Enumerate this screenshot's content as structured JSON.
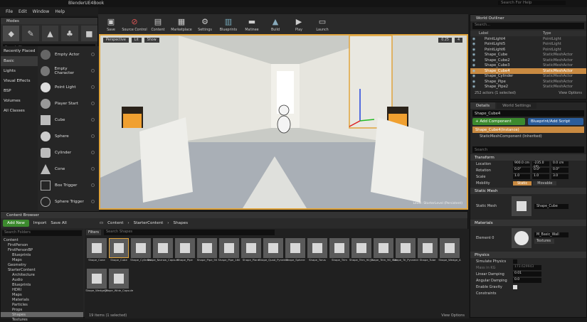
{
  "window": {
    "title": "BlenderUE4Book",
    "help_search": "Search For Help"
  },
  "menu": [
    "File",
    "Edit",
    "Window",
    "Help"
  ],
  "toolbar": [
    {
      "label": "Save",
      "icon": "save-icon"
    },
    {
      "label": "Source Control",
      "icon": "source-control-icon"
    },
    {
      "label": "Content",
      "icon": "content-icon"
    },
    {
      "label": "Marketplace",
      "icon": "marketplace-icon"
    },
    {
      "label": "Settings",
      "icon": "settings-icon"
    },
    {
      "label": "Blueprints",
      "icon": "blueprints-icon"
    },
    {
      "label": "Matinee",
      "icon": "matinee-icon"
    },
    {
      "label": "Build",
      "icon": "build-icon"
    },
    {
      "label": "Play",
      "icon": "play-icon"
    },
    {
      "label": "Launch",
      "icon": "launch-icon"
    }
  ],
  "modes": {
    "tab": "Modes",
    "search_placeholder": "Search Classes",
    "categories": [
      "Recently Placed",
      "Basic",
      "Lights",
      "Visual Effects",
      "BSP",
      "Volumes",
      "All Classes"
    ],
    "selected_category": "Basic",
    "items": [
      "Empty Actor",
      "Empty Character",
      "Point Light",
      "Player Start",
      "Cube",
      "Sphere",
      "Cylinder",
      "Cone",
      "Box Trigger",
      "Sphere Trigger"
    ]
  },
  "viewport": {
    "buttons": [
      "Perspective",
      "Lit",
      "Show"
    ],
    "readouts": [
      "0.25",
      "4"
    ],
    "level_label": "Level: StarterLevel (Persistent)"
  },
  "outliner": {
    "tab": "World Outliner",
    "search_placeholder": "Search...",
    "col_label": "Label",
    "col_type": "Type",
    "rows": [
      {
        "name": "PointLight4",
        "type": "PointLight"
      },
      {
        "name": "PointLight5",
        "type": "PointLight"
      },
      {
        "name": "PointLight6",
        "type": "PointLight"
      },
      {
        "name": "Shape_Cube",
        "type": "StaticMeshActor"
      },
      {
        "name": "Shape_Cube2",
        "type": "StaticMeshActor"
      },
      {
        "name": "Shape_Cube3",
        "type": "StaticMeshActor"
      },
      {
        "name": "Shape_Cube4",
        "type": "StaticMeshActor",
        "selected": true
      },
      {
        "name": "Shape_Cylinder",
        "type": "StaticMeshActor"
      },
      {
        "name": "Shape_Pipe",
        "type": "StaticMeshActor"
      },
      {
        "name": "Shape_Pipe2",
        "type": "StaticMeshActor"
      }
    ],
    "footer": "252 actors (1 selected)",
    "view_options": "View Options"
  },
  "details": {
    "tab": "Details",
    "tab2": "World Settings",
    "name": "Shape_Cube4",
    "add_component": "+ Add Component",
    "blueprint": "Blueprint/Add Script",
    "components": [
      "Shape_Cube4(Instance)",
      "StaticMeshComponent (Inherited)"
    ],
    "search_placeholder": "Search",
    "transform": "Transform",
    "location": {
      "label": "Location",
      "x": "900.0 cm",
      "y": "-235.0 cm",
      "z": "0.0 cm"
    },
    "rotation": {
      "label": "Rotation",
      "x": "0.0°",
      "y": "0.0°",
      "z": "0.0°"
    },
    "scale": {
      "label": "Scale",
      "x": "1.0",
      "y": "1.0",
      "z": "3.0"
    },
    "mobility": {
      "label": "Mobility",
      "static": "Static",
      "movable": "Movable"
    },
    "static_mesh_section": "Static Mesh",
    "static_mesh_label": "Static Mesh",
    "static_mesh_value": "Shape_Cube",
    "materials_section": "Materials",
    "element0": "Element 0",
    "material_value": "M_Basic_Wall",
    "textures": "Textures",
    "physics_section": "Physics",
    "physics_rows": [
      "Simulate Physics",
      "Mass in KG",
      "Linear Damping",
      "Angular Damping",
      "Enable Gravity",
      "Constraints"
    ],
    "mass_value": "173.629943",
    "linear_damping": "0.01",
    "angular_damping": "0.0"
  },
  "content": {
    "tab": "Content Browser",
    "add_new": "Add New",
    "import": "Import",
    "save_all": "Save All",
    "breadcrumb": [
      "Content",
      "StarterContent",
      "Shapes"
    ],
    "folder_search": "Search Folders",
    "asset_search": "Search Shapes",
    "filters": "Filters",
    "tree": [
      "Content",
      "FirstPerson",
      "FirstPersonBP",
      "Blueprints",
      "Maps",
      "Geometry",
      "StarterContent",
      "Architecture",
      "Audio",
      "Blueprints",
      "HDRI",
      "Maps",
      "Materials",
      "Particles",
      "Props",
      "Shapes",
      "Textures"
    ],
    "selected_tree": "Shapes",
    "assets": [
      "Shape_Cone",
      "Shape_Cube",
      "Shape_Cylinder",
      "Shape_Narrow_Capsule",
      "Shape_Pipe",
      "Shape_Pipe_90",
      "Shape_Pipe_180",
      "Shape_Plane",
      "Shape_Quad_Pyramid",
      "Shape_Sphere",
      "Shape_Torus",
      "Shape_Trim",
      "Shape_Trim_90_In",
      "Shape_Trim_90_Out",
      "Shape_Tri_Pyramid",
      "Shape_Tube",
      "Shape_Wedge_A",
      "Shape_Wedge_B",
      "Shape_Wide_Capsule"
    ],
    "selected_asset": "Shape_Cube",
    "footer": "19 items (1 selected)",
    "view_options": "View Options"
  }
}
